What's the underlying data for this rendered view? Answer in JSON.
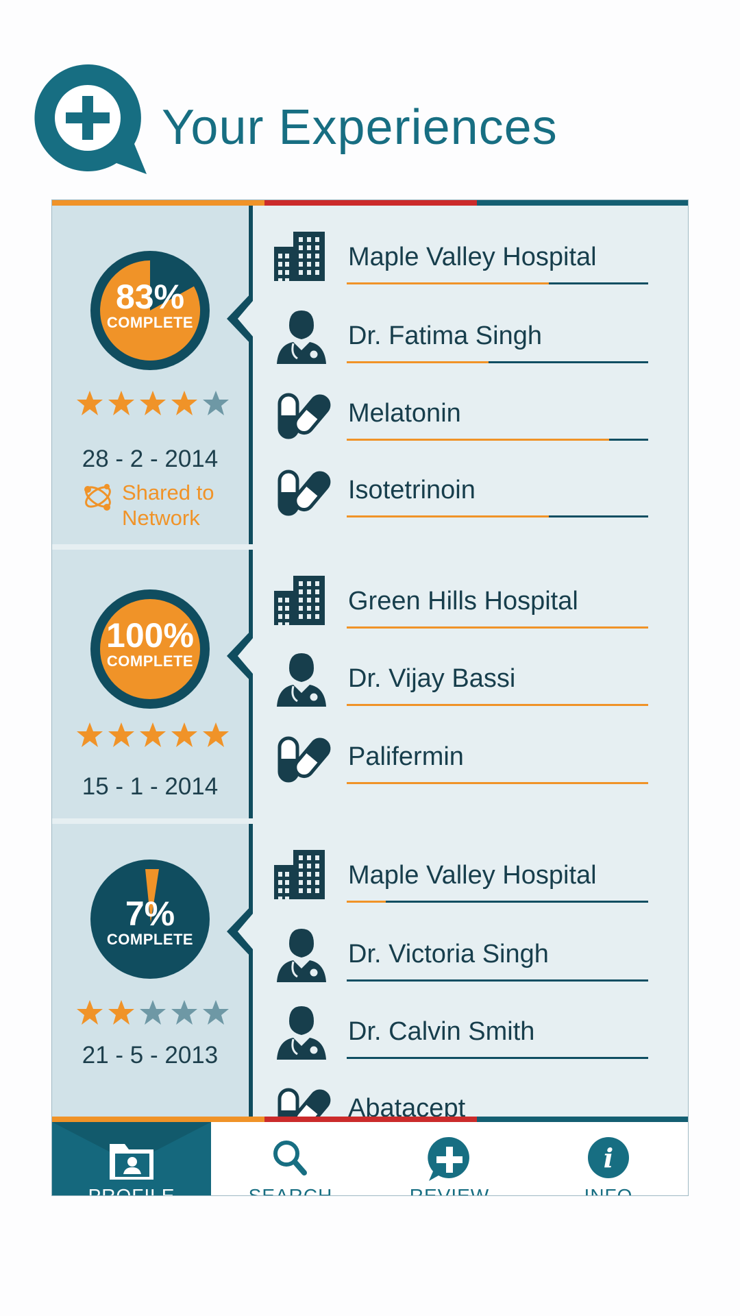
{
  "header": {
    "title": "Your Experiences",
    "logo_icon": "plus-chat-bubble-icon"
  },
  "colors": {
    "teal": "#176e82",
    "dark": "#104d5f",
    "orange": "#f09328",
    "red": "#cb2b2b",
    "grey_star": "#6e98a5"
  },
  "experiences": [
    {
      "percent": "83%",
      "complete_label": "COMPLETE",
      "progress": 0.83,
      "rating": 4,
      "max_rating": 5,
      "date": "28 - 2 - 2014",
      "shared": "Shared to Network",
      "items": [
        {
          "type": "hospital",
          "icon": "hospital-building-icon",
          "name": "Maple Valley Hospital",
          "progress": 0.67
        },
        {
          "type": "doctor",
          "icon": "doctor-icon",
          "name": "Dr. Fatima Singh",
          "progress": 0.47
        },
        {
          "type": "drug",
          "icon": "pill-capsule-icon",
          "name": "Melatonin",
          "progress": 0.87
        },
        {
          "type": "drug",
          "icon": "pill-capsule-icon",
          "name": "Isotetrinoin",
          "progress": 0.67
        }
      ]
    },
    {
      "percent": "100%",
      "complete_label": "COMPLETE",
      "progress": 1.0,
      "rating": 5,
      "max_rating": 5,
      "date": "15 - 1 - 2014",
      "items": [
        {
          "type": "hospital",
          "icon": "hospital-building-icon",
          "name": "Green Hills Hospital",
          "progress": 1.0
        },
        {
          "type": "doctor",
          "icon": "doctor-icon",
          "name": "Dr. Vijay Bassi",
          "progress": 1.0
        },
        {
          "type": "drug",
          "icon": "pill-capsule-icon",
          "name": "Palifermin",
          "progress": 1.0
        }
      ]
    },
    {
      "percent": "7%",
      "complete_label": "COMPLETE",
      "progress": 0.07,
      "rating": 2,
      "max_rating": 5,
      "date": "21 - 5 - 2013",
      "items": [
        {
          "type": "hospital",
          "icon": "hospital-building-icon",
          "name": "Maple Valley Hospital",
          "progress": 0.13
        },
        {
          "type": "doctor",
          "icon": "doctor-icon",
          "name": "Dr. Victoria Singh",
          "progress": 0
        },
        {
          "type": "doctor",
          "icon": "doctor-icon",
          "name": "Dr. Calvin Smith",
          "progress": 0
        },
        {
          "type": "drug",
          "icon": "pill-capsule-icon",
          "name": "Abatacept",
          "progress": 0
        }
      ]
    }
  ],
  "nav": [
    {
      "label": "PROFILE",
      "icon": "profile-folder-icon",
      "active": true
    },
    {
      "label": "SEARCH",
      "icon": "search-icon",
      "active": false
    },
    {
      "label": "REVIEW",
      "icon": "review-plus-icon",
      "active": false
    },
    {
      "label": "INFO",
      "icon": "info-icon",
      "active": false
    }
  ]
}
